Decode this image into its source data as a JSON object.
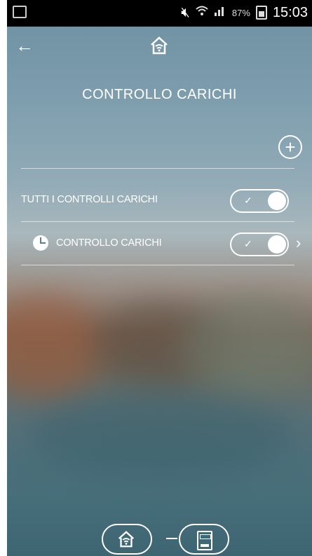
{
  "status_bar": {
    "battery": "87%",
    "time": "15:03",
    "icons": [
      "screenshot-icon",
      "mute-icon",
      "wifi-icon",
      "signal-icon",
      "battery-charging-icon"
    ]
  },
  "nav": {
    "back_icon": "back-arrow-icon",
    "home_icon": "home-wifi-icon"
  },
  "page": {
    "title": "CONTROLLO CARICHI",
    "add_icon": "plus-circle-icon"
  },
  "rows": [
    {
      "label": "TUTTI I CONTROLLI CARICHI",
      "toggle_on": true
    },
    {
      "label": "CONTROLLO CARICHI",
      "icon": "clock-icon",
      "toggle_on": true,
      "chevron": "chevron-right-icon"
    }
  ],
  "bottom_nav": {
    "home_icon": "home-wifi-icon",
    "device_icon": "device-panel-icon"
  }
}
